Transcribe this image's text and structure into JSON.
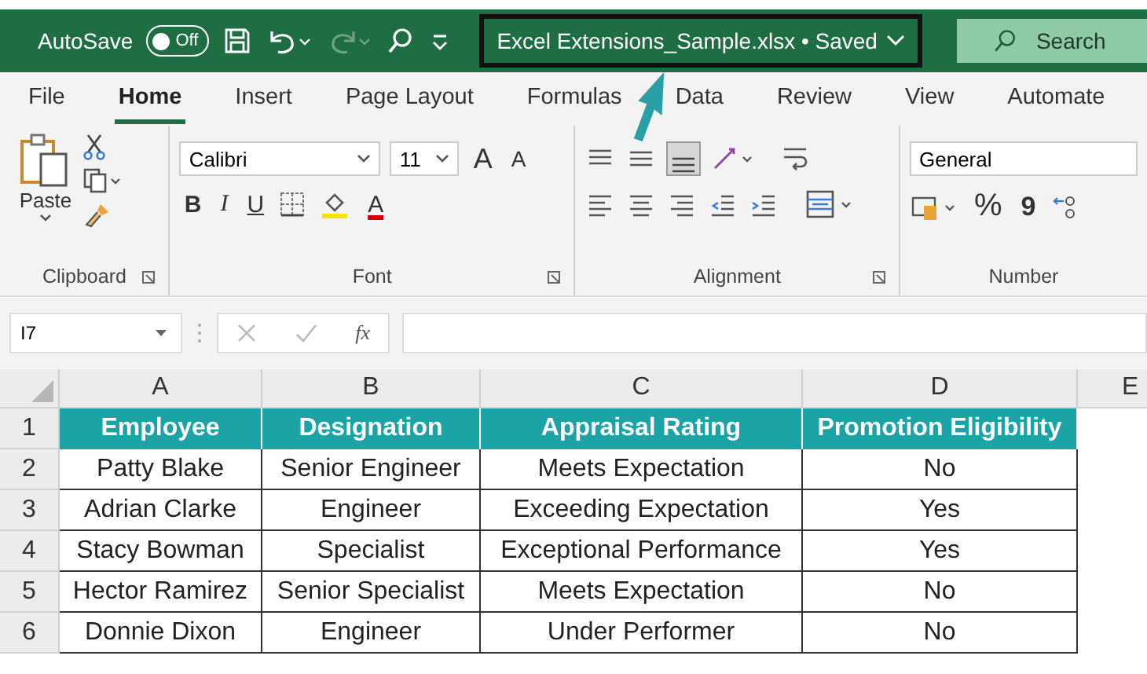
{
  "title_bar": {
    "autosave_label": "AutoSave",
    "autosave_toggle": {
      "label": "Off",
      "on": false
    },
    "document_title": "Excel Extensions_Sample.xlsx • Saved",
    "search_placeholder": "Search"
  },
  "ribbon_tabs": [
    {
      "label": "File",
      "selected": false
    },
    {
      "label": "Home",
      "selected": true
    },
    {
      "label": "Insert",
      "selected": false
    },
    {
      "label": "Page Layout",
      "selected": false
    },
    {
      "label": "Formulas",
      "selected": false
    },
    {
      "label": "Data",
      "selected": false
    },
    {
      "label": "Review",
      "selected": false
    },
    {
      "label": "View",
      "selected": false
    },
    {
      "label": "Automate",
      "selected": false
    }
  ],
  "ribbon": {
    "clipboard": {
      "paste_label": "Paste",
      "group_label": "Clipboard"
    },
    "font": {
      "font_name": "Calibri",
      "font_size": "11",
      "grow_label": "A",
      "shrink_label": "A",
      "bold": "B",
      "italic": "I",
      "underline": "U",
      "font_color_label": "A",
      "group_label": "Font"
    },
    "alignment": {
      "group_label": "Alignment"
    },
    "number": {
      "format": "General",
      "percent": "%",
      "comma": "9",
      "group_label": "Number"
    }
  },
  "formula_bar": {
    "name_box": "I7",
    "function_label": "fx"
  },
  "sheet": {
    "column_letters": [
      "A",
      "B",
      "C",
      "D",
      "E"
    ],
    "header_row": {
      "number": "1",
      "cells": [
        "Employee",
        "Designation",
        "Appraisal Rating",
        "Promotion Eligibility"
      ]
    },
    "rows": [
      {
        "number": "2",
        "cells": [
          "Patty Blake",
          "Senior Engineer",
          "Meets Expectation",
          "No"
        ]
      },
      {
        "number": "3",
        "cells": [
          "Adrian Clarke",
          "Engineer",
          "Exceeding Expectation",
          "Yes"
        ]
      },
      {
        "number": "4",
        "cells": [
          "Stacy Bowman",
          "Specialist",
          "Exceptional Performance",
          "Yes"
        ]
      },
      {
        "number": "5",
        "cells": [
          "Hector Ramirez",
          "Senior Specialist",
          "Meets Expectation",
          "No"
        ]
      },
      {
        "number": "6",
        "cells": [
          "Donnie Dixon",
          "Engineer",
          "Under Performer",
          "No"
        ]
      }
    ]
  }
}
